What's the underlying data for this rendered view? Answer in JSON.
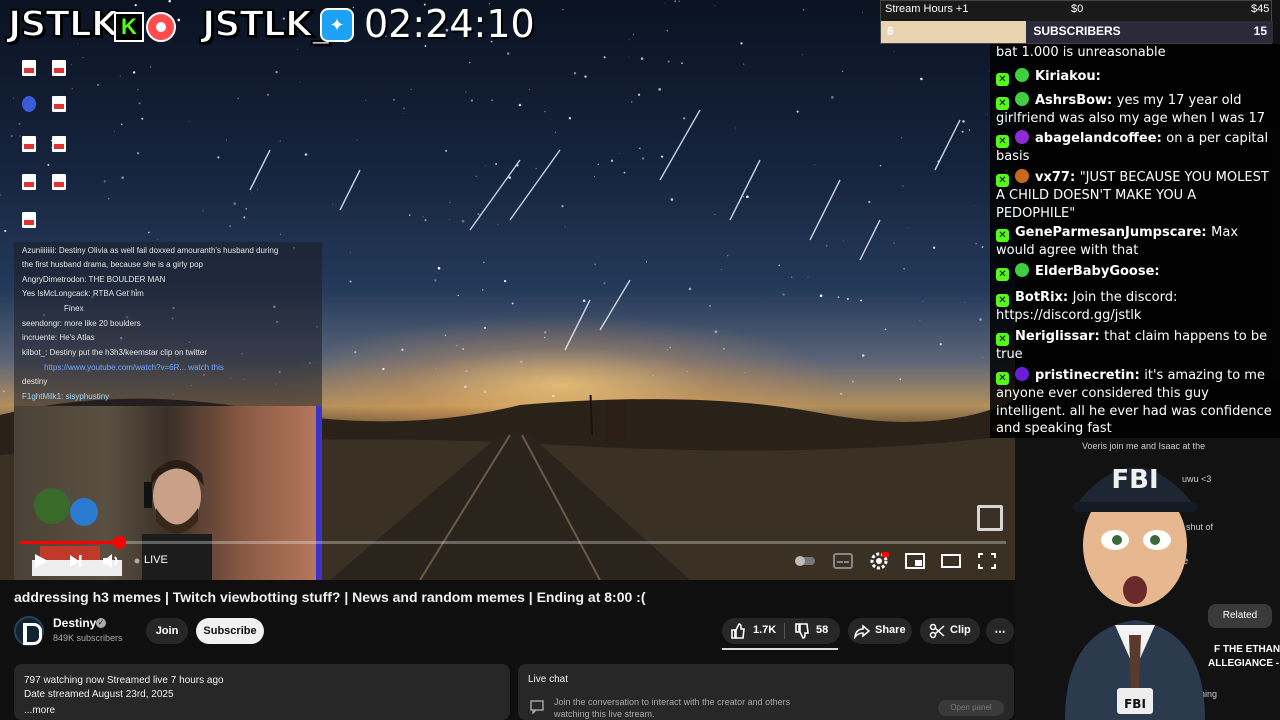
{
  "overlay": {
    "logo_left": "JSTLK",
    "kick_mark": "K",
    "logo_right": "JSTLK_",
    "timer": "02:24:10"
  },
  "stream_hours": {
    "label": "Stream Hours +1",
    "mid_value": "$0",
    "right_value": "$45",
    "subs_left": "6",
    "subs_title": "SUBSCRIBERS",
    "subs_right": "15",
    "subs_progress": 0.37
  },
  "chat": {
    "messages": [
      {
        "name": "",
        "text": "bat 1.000 is unreasonable",
        "avatar_color": ""
      },
      {
        "name": "Kiriakou:",
        "text": "",
        "avatar_color": "#3ecf3e"
      },
      {
        "name": "AshrsBow:",
        "text": "yes my 17 year old girlfriend was also my age when I was 17",
        "avatar_color": "#3ecf3e"
      },
      {
        "name": "abagelandcoffee:",
        "text": "on a per capital basis",
        "avatar_color": "#8e2bd6"
      },
      {
        "name": "vx77:",
        "text": "\"JUST BECAUSE YOU MOLEST A CHILD DOESN'T MAKE YOU A PEDOPHILE\"",
        "avatar_color": "#c86a1c"
      },
      {
        "name": "GeneParmesanJumpscare:",
        "text": "Max would agree with that",
        "avatar_color": ""
      },
      {
        "name": "ElderBabyGoose:",
        "text": "",
        "avatar_color": "#3ecf3e"
      },
      {
        "name": "BotRix:",
        "text": "Join the discord: https://discord.gg/jstlk",
        "avatar_color": ""
      },
      {
        "name": "Neriglissar:",
        "text": "that claim happens to be true",
        "avatar_color": ""
      },
      {
        "name": "pristinecretin:",
        "text": "it's amazing to me anyone ever considered this guy intelligent. all he ever had was confidence and speaking fast",
        "avatar_color": "#6a1fd6"
      }
    ]
  },
  "mini_chat": {
    "lines": [
      "Azuniiiiiiii: Destiny Olivia as well fail doxxed amouranth's husband during",
      "the first husband drama, because she is a girly pop",
      "AngryDimetrodon: THE BOULDER MAN",
      "Yes IsMcLongcack: RTBA Get him",
      "Finex",
      "seendongr: more like 20 boulders",
      "incruente: He's Atlas",
      "kilbot_: Destiny put the h3h3/keemstar clip on twitter",
      "https://www.youtube.com/watch?v=6R... watch this",
      "destiny",
      "F1ghtMilk1: sisyphustiny"
    ]
  },
  "player": {
    "live_label": "LIVE",
    "progress": 0.1
  },
  "video": {
    "title": "addressing h3 memes | Twitch viewbotting stuff? | News and random memes | Ending at 8:00 :(",
    "channel_name": "Destiny",
    "subscribers": "849K subscribers",
    "join_label": "Join",
    "subscribe_label": "Subscribe",
    "likes": "1.7K",
    "dislikes": "58",
    "share_label": "Share",
    "clip_label": "Clip"
  },
  "description": {
    "line1": "797 watching now  Streamed live 7 hours ago",
    "line2": "Date streamed August 23rd, 2025",
    "more": "...more"
  },
  "live_chat_panel": {
    "title": "Live chat",
    "message": "Join the conversation to interact with the creator and others watching this live stream.",
    "open_panel": "Open panel"
  },
  "sidebar": {
    "line1": "Voeris join me and Isaac at the",
    "line2": "uwu <3",
    "line3": "ta shut of",
    "line4": "node",
    "related": "Related",
    "video_title_1": "F THE ETHAN",
    "video_title_2": "ALLEGIANCE -",
    "video_meta_1": "an",
    "video_meta_2": "546 watching",
    "mascot_text": "FBI"
  }
}
